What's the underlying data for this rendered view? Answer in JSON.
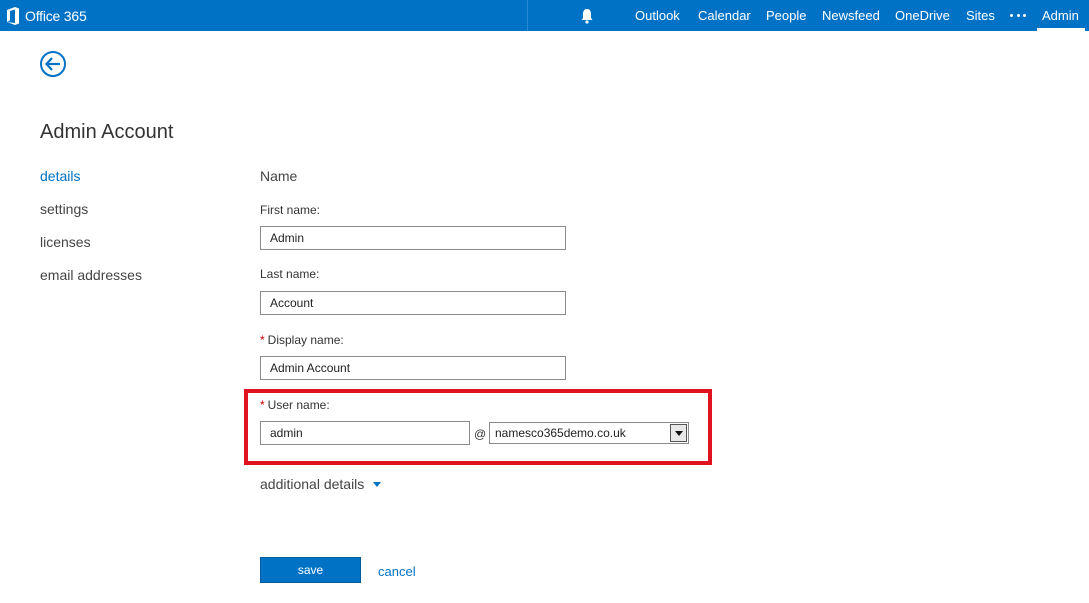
{
  "topbar": {
    "brand": "Office 365",
    "nav": [
      "Outlook",
      "Calendar",
      "People",
      "Newsfeed",
      "OneDrive",
      "Sites",
      "Admin"
    ],
    "active": "Admin",
    "icons": [
      "office-logo-icon",
      "bell-icon",
      "ellipsis-icon"
    ]
  },
  "page": {
    "title": "Admin Account"
  },
  "leftnav": {
    "items": [
      "details",
      "settings",
      "licenses",
      "email addresses"
    ],
    "selected": "details"
  },
  "form": {
    "section_title": "Name",
    "first_name_label": "First name:",
    "first_name_value": "Admin",
    "last_name_label": "Last name:",
    "last_name_value": "Account",
    "display_name_label": "Display name:",
    "display_name_value": "Admin Account",
    "user_name_label": "User name:",
    "user_name_value": "admin",
    "at_sign": "@",
    "domain_selected": "namesco365demo.co.uk",
    "required_marker": "*",
    "additional_details": "additional details"
  },
  "actions": {
    "save": "save",
    "cancel": "cancel"
  },
  "colors": {
    "brand_blue": "#0072c6",
    "highlight_red": "#e0121f",
    "required_red": "#cc0000"
  }
}
